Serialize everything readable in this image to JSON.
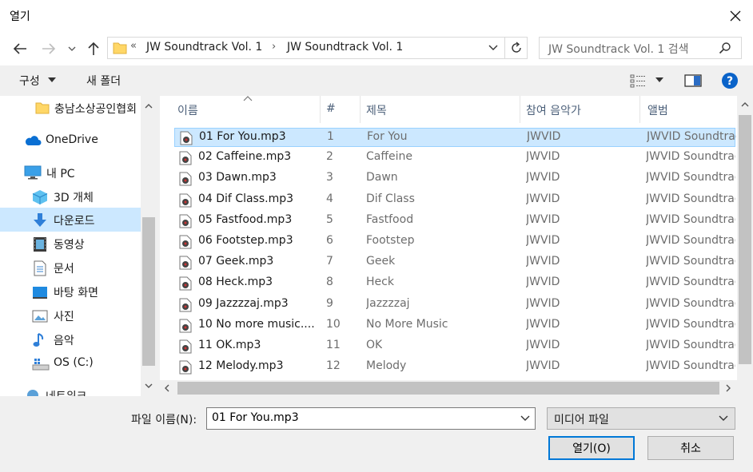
{
  "window": {
    "title": "열기"
  },
  "address": {
    "crumbs": [
      "JW Soundtrack Vol. 1",
      "JW Soundtrack Vol. 1"
    ],
    "overflow_chevron": "«",
    "separator": "›"
  },
  "search": {
    "placeholder": "JW Soundtrack Vol. 1 검색"
  },
  "toolbar": {
    "organize_label": "구성",
    "new_folder_label": "새 폴더"
  },
  "nav": {
    "items": [
      {
        "label": "충남소상공인협회",
        "icon": "folder-icon"
      },
      {
        "label": "OneDrive",
        "icon": "cloud-icon"
      },
      {
        "label": "내 PC",
        "icon": "pc-icon"
      },
      {
        "label": "3D 개체",
        "icon": "cube-icon"
      },
      {
        "label": "다운로드",
        "icon": "download-icon",
        "selected": true
      },
      {
        "label": "동영상",
        "icon": "video-icon"
      },
      {
        "label": "문서",
        "icon": "document-icon"
      },
      {
        "label": "바탕 화면",
        "icon": "desktop-icon"
      },
      {
        "label": "사진",
        "icon": "picture-icon"
      },
      {
        "label": "음악",
        "icon": "music-icon"
      },
      {
        "label": "OS (C:)",
        "icon": "drive-icon"
      },
      {
        "label": "네트워크",
        "icon": "network-icon"
      }
    ]
  },
  "columns": [
    "이름",
    "#",
    "제목",
    "참여 음악가",
    "앨범"
  ],
  "files": [
    {
      "name": "01 For You.mp3",
      "num": "1",
      "title": "For You",
      "artist": "JWVID",
      "album": "JWVID Soundtrack"
    },
    {
      "name": "02 Caffeine.mp3",
      "num": "2",
      "title": "Caffeine",
      "artist": "JWVID",
      "album": "JWVID Soundtrack"
    },
    {
      "name": "03 Dawn.mp3",
      "num": "3",
      "title": "Dawn",
      "artist": "JWVID",
      "album": "JWVID Soundtrack"
    },
    {
      "name": "04 Dif Class.mp3",
      "num": "4",
      "title": "Dif Class",
      "artist": "JWVID",
      "album": "JWVID Soundtrack"
    },
    {
      "name": "05 Fastfood.mp3",
      "num": "5",
      "title": "Fastfood",
      "artist": "JWVID",
      "album": "JWVID Soundtrack"
    },
    {
      "name": "06 Footstep.mp3",
      "num": "6",
      "title": "Footstep",
      "artist": "JWVID",
      "album": "JWVID Soundtrack"
    },
    {
      "name": "07 Geek.mp3",
      "num": "7",
      "title": "Geek",
      "artist": "JWVID",
      "album": "JWVID Soundtrack"
    },
    {
      "name": "08 Heck.mp3",
      "num": "8",
      "title": "Heck",
      "artist": "JWVID",
      "album": "JWVID Soundtrack"
    },
    {
      "name": "09 Jazzzzaj.mp3",
      "num": "9",
      "title": "Jazzzzaj",
      "artist": "JWVID",
      "album": "JWVID Soundtrack"
    },
    {
      "name": "10 No more music....",
      "num": "10",
      "title": "No More Music",
      "artist": "JWVID",
      "album": "JWVID Soundtrack"
    },
    {
      "name": "11 OK.mp3",
      "num": "11",
      "title": "OK",
      "artist": "JWVID",
      "album": "JWVID Soundtrack"
    },
    {
      "name": "12 Melody.mp3",
      "num": "12",
      "title": "Melody",
      "artist": "JWVID",
      "album": "JWVID Soundtrack"
    }
  ],
  "filename": {
    "label": "파일 이름(N):",
    "value": "01 For You.mp3"
  },
  "filetype": {
    "value": "미디어 파일"
  },
  "buttons": {
    "open": "열기(O)",
    "cancel": "취소"
  },
  "colors": {
    "selection": "#cce8ff",
    "accent": "#0078d7"
  }
}
